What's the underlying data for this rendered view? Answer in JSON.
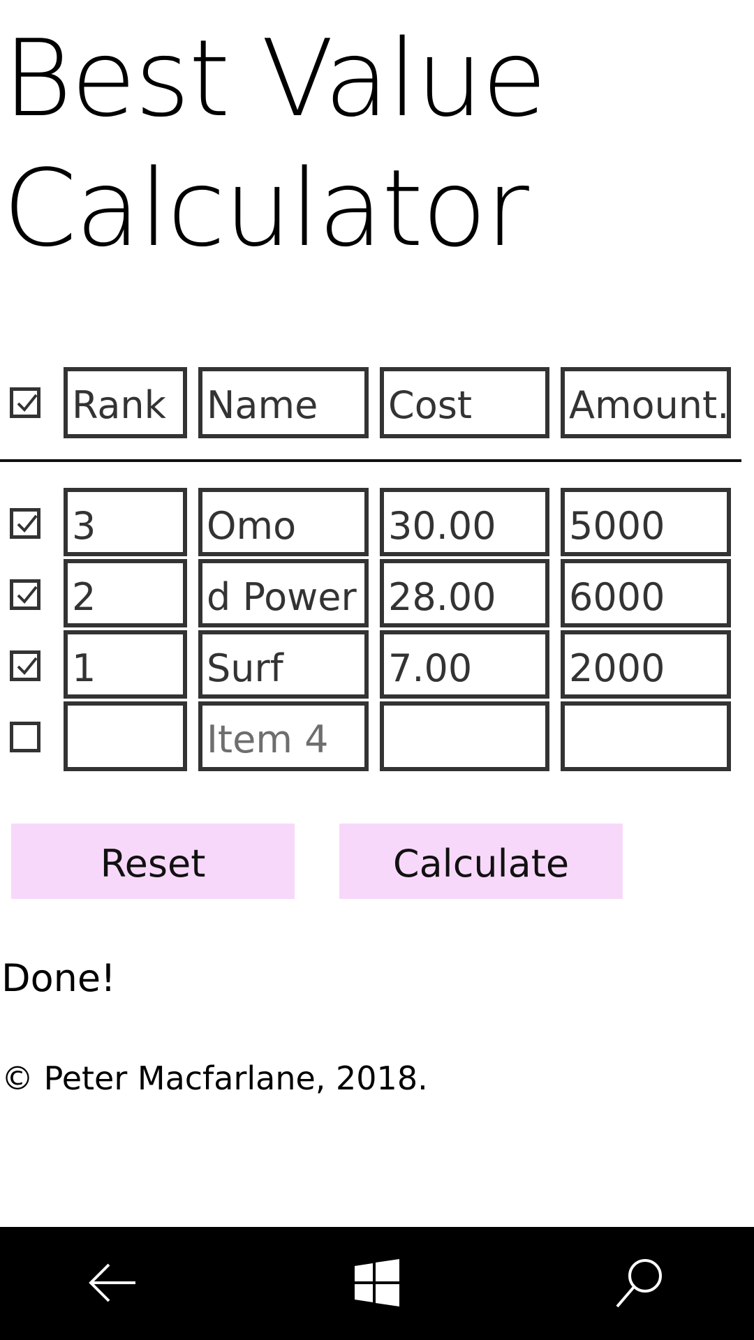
{
  "title": {
    "line1": "Best Value",
    "line2": "Calculator"
  },
  "header": {
    "checked": true,
    "columns": [
      "Rank",
      "Name",
      "Cost",
      "Amount."
    ]
  },
  "rows": [
    {
      "checked": true,
      "rank": "3",
      "name": "Omo",
      "cost": "30.00",
      "amount": "5000"
    },
    {
      "checked": true,
      "rank": "2",
      "name": "d Power",
      "cost": "28.00",
      "amount": "6000"
    },
    {
      "checked": true,
      "rank": "1",
      "name": "Surf",
      "cost": "7.00",
      "amount": "2000"
    },
    {
      "checked": false,
      "rank": "",
      "name_placeholder": "Item 4",
      "cost": "",
      "amount": ""
    }
  ],
  "buttons": {
    "reset": "Reset",
    "calculate": "Calculate"
  },
  "status": "Done!",
  "copyright": "© Peter Macfarlane, 2018.",
  "colors": {
    "button_bg": "#f8d8fa",
    "cell_border": "#333333",
    "navbar_bg": "#000000"
  },
  "navbar": {
    "icons": [
      "back-arrow-icon",
      "windows-icon",
      "search-icon"
    ]
  }
}
